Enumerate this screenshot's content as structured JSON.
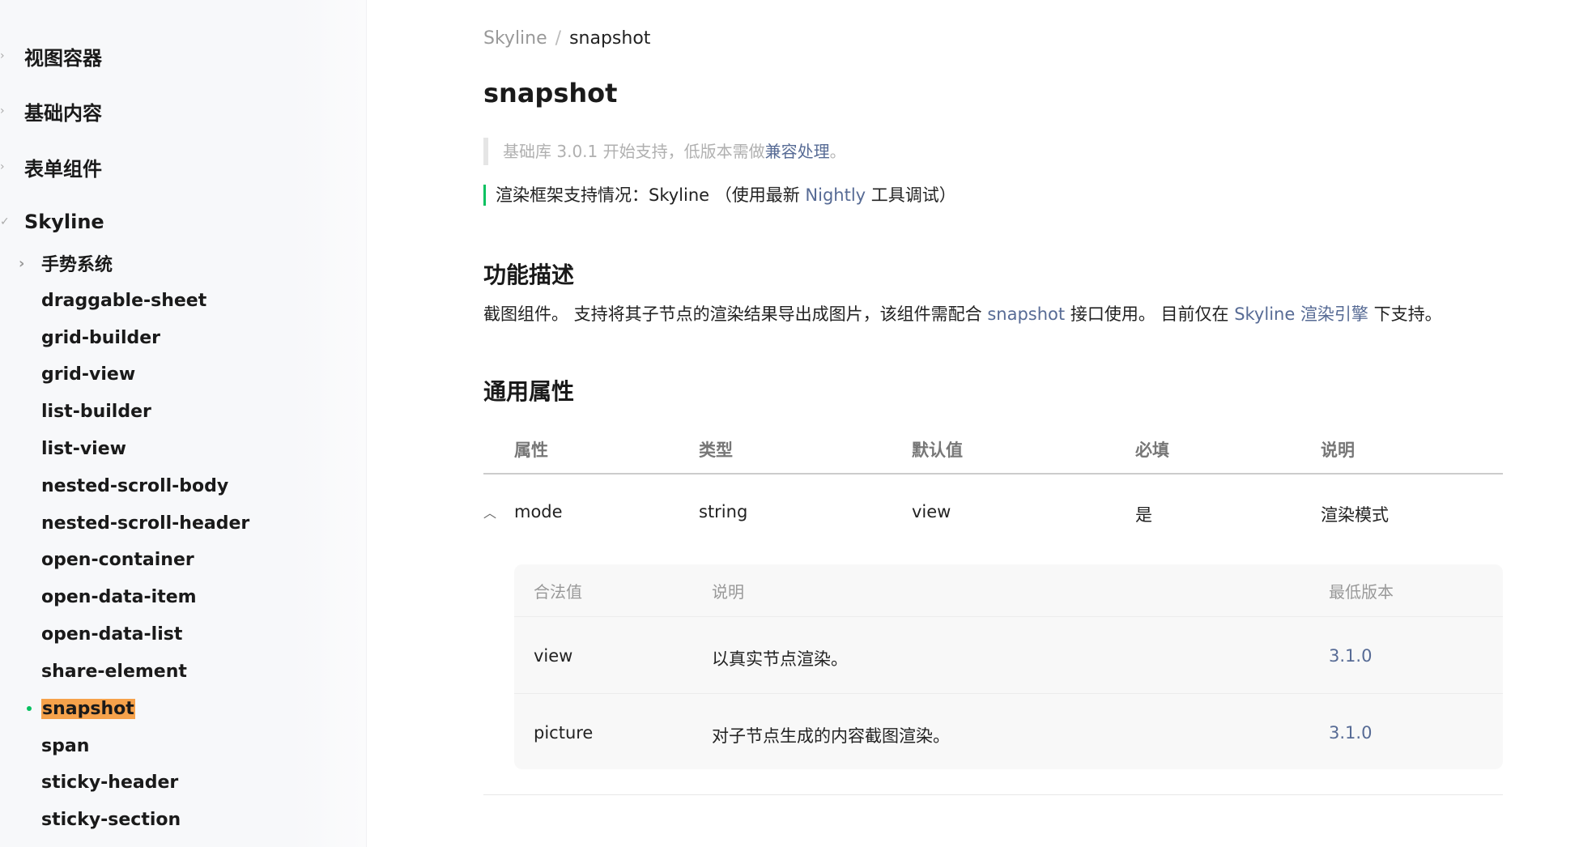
{
  "sidebar": {
    "top_items": [
      {
        "label": "视图容器"
      },
      {
        "label": "基础内容"
      },
      {
        "label": "表单组件"
      },
      {
        "label": "Skyline"
      }
    ],
    "skyline_children": [
      {
        "label": "手势系统"
      },
      {
        "label": "draggable-sheet"
      },
      {
        "label": "grid-builder"
      },
      {
        "label": "grid-view"
      },
      {
        "label": "list-builder"
      },
      {
        "label": "list-view"
      },
      {
        "label": "nested-scroll-body"
      },
      {
        "label": "nested-scroll-header"
      },
      {
        "label": "open-container"
      },
      {
        "label": "open-data-item"
      },
      {
        "label": "open-data-list"
      },
      {
        "label": "share-element"
      },
      {
        "label": "snapshot"
      },
      {
        "label": "span"
      },
      {
        "label": "sticky-header"
      },
      {
        "label": "sticky-section"
      }
    ],
    "active_color": "#07c160",
    "highlight_color": "#f6a24b"
  },
  "breadcrumb": {
    "root": "Skyline",
    "separator": "/",
    "current": "snapshot"
  },
  "page_title": "snapshot",
  "note": {
    "prefix": "基础库 3.0.1 开始支持，低版本需做",
    "link": "兼容处理",
    "suffix": "。"
  },
  "support": {
    "prefix": "渲染框架支持情况：Skyline （使用最新 ",
    "link": "Nightly",
    "suffix": " 工具调试）"
  },
  "sections": {
    "feature_heading": "功能描述",
    "props_heading": "通用属性"
  },
  "description": {
    "p1": "截图组件。 支持将其子节点的渲染结果导出成图片，该组件需配合 ",
    "link1": "snapshot",
    "p2": " 接口使用。 目前仅在 ",
    "link2": "Skyline 渲染引擎",
    "p3": " 下支持。"
  },
  "table": {
    "headers": [
      "属性",
      "类型",
      "默认值",
      "必填",
      "说明"
    ],
    "row": {
      "name": "mode",
      "type": "string",
      "default": "view",
      "required": "是",
      "desc": "渲染模式"
    },
    "sub_headers": [
      "合法值",
      "说明",
      "最低版本"
    ],
    "sub_rows": [
      {
        "value": "view",
        "desc": "以真实节点渲染。",
        "version": "3.1.0"
      },
      {
        "value": "picture",
        "desc": "对子节点生成的内容截图渲染。",
        "version": "3.1.0"
      }
    ]
  },
  "colors": {
    "link": "#576b95",
    "accent": "#07c160"
  }
}
